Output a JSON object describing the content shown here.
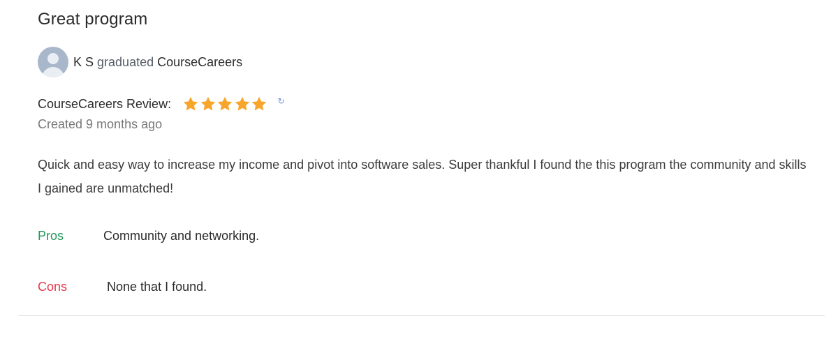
{
  "review": {
    "title": "Great program",
    "author": {
      "name": "K S",
      "action": "graduated",
      "school": "CourseCareers"
    },
    "rating": {
      "label": "CourseCareers Review:",
      "stars": 5,
      "max_stars": 5,
      "star_color": "#f7a52b",
      "icon": "rating-info-icon"
    },
    "created": "Created 9 months ago",
    "body": "Quick and easy way to increase my income and pivot into software sales. Super thankful I found the this program the community and skills I gained are unmatched!",
    "pros": {
      "label": "Pros",
      "text": "Community and networking.",
      "color": "#22985a"
    },
    "cons": {
      "label": "Cons",
      "text": "None that I found.",
      "color": "#e5394b"
    }
  }
}
